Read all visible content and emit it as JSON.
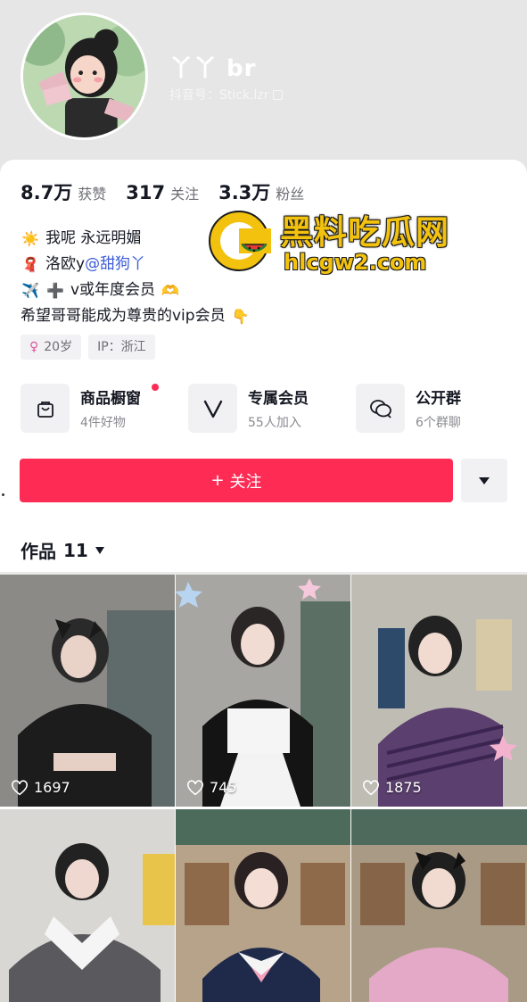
{
  "profile": {
    "nickname": "丫丫 br",
    "douyin_id": "抖音号：Stick.lzr",
    "avatar_icon": "avatar-cartoon-girl"
  },
  "stats": [
    {
      "value": "8.7万",
      "label": "获赞"
    },
    {
      "value": "317",
      "label": "关注"
    },
    {
      "value": "3.3万",
      "label": "粉丝"
    }
  ],
  "bio": {
    "line1_emoji": "☀️",
    "line1": "我呢 永远明媚",
    "line2_emoji": "🧣",
    "line2": "洛欧y",
    "line2_mention": "@甜狗丫",
    "line3_emoji": "✈️",
    "line3_plus": "➕",
    "line3": "v或年度会员",
    "line3_end": "🫶",
    "line4": "希望哥哥能成为尊贵的vip会员",
    "line4_end": "👇"
  },
  "tags": [
    {
      "icon": "female-icon",
      "text": "20岁"
    },
    {
      "text": "IP：浙江"
    }
  ],
  "services": [
    {
      "icon": "shopping-bag-icon",
      "title": "商品橱窗",
      "subtitle": "4件好物",
      "has_dot": true
    },
    {
      "icon": "vip-v-icon",
      "title": "专属会员",
      "subtitle": "55人加入",
      "has_dot": false
    },
    {
      "icon": "chat-group-icon",
      "title": "公开群",
      "subtitle": "6个群聊",
      "has_dot": false
    }
  ],
  "follow_button": {
    "plus": "+",
    "label": "关注"
  },
  "works_tab": {
    "label": "作品",
    "count": "11"
  },
  "watermark": {
    "title": "黑料吃瓜网",
    "url": "hlcgw2.com"
  },
  "videos": [
    {
      "likes": "1697"
    },
    {
      "likes": "745"
    },
    {
      "likes": "1875"
    },
    {
      "likes": ""
    },
    {
      "likes": ""
    },
    {
      "likes": ""
    }
  ],
  "colors": {
    "accent": "#fe2c55",
    "mention": "#3b5bd6",
    "watermark": "#f2c20e"
  }
}
